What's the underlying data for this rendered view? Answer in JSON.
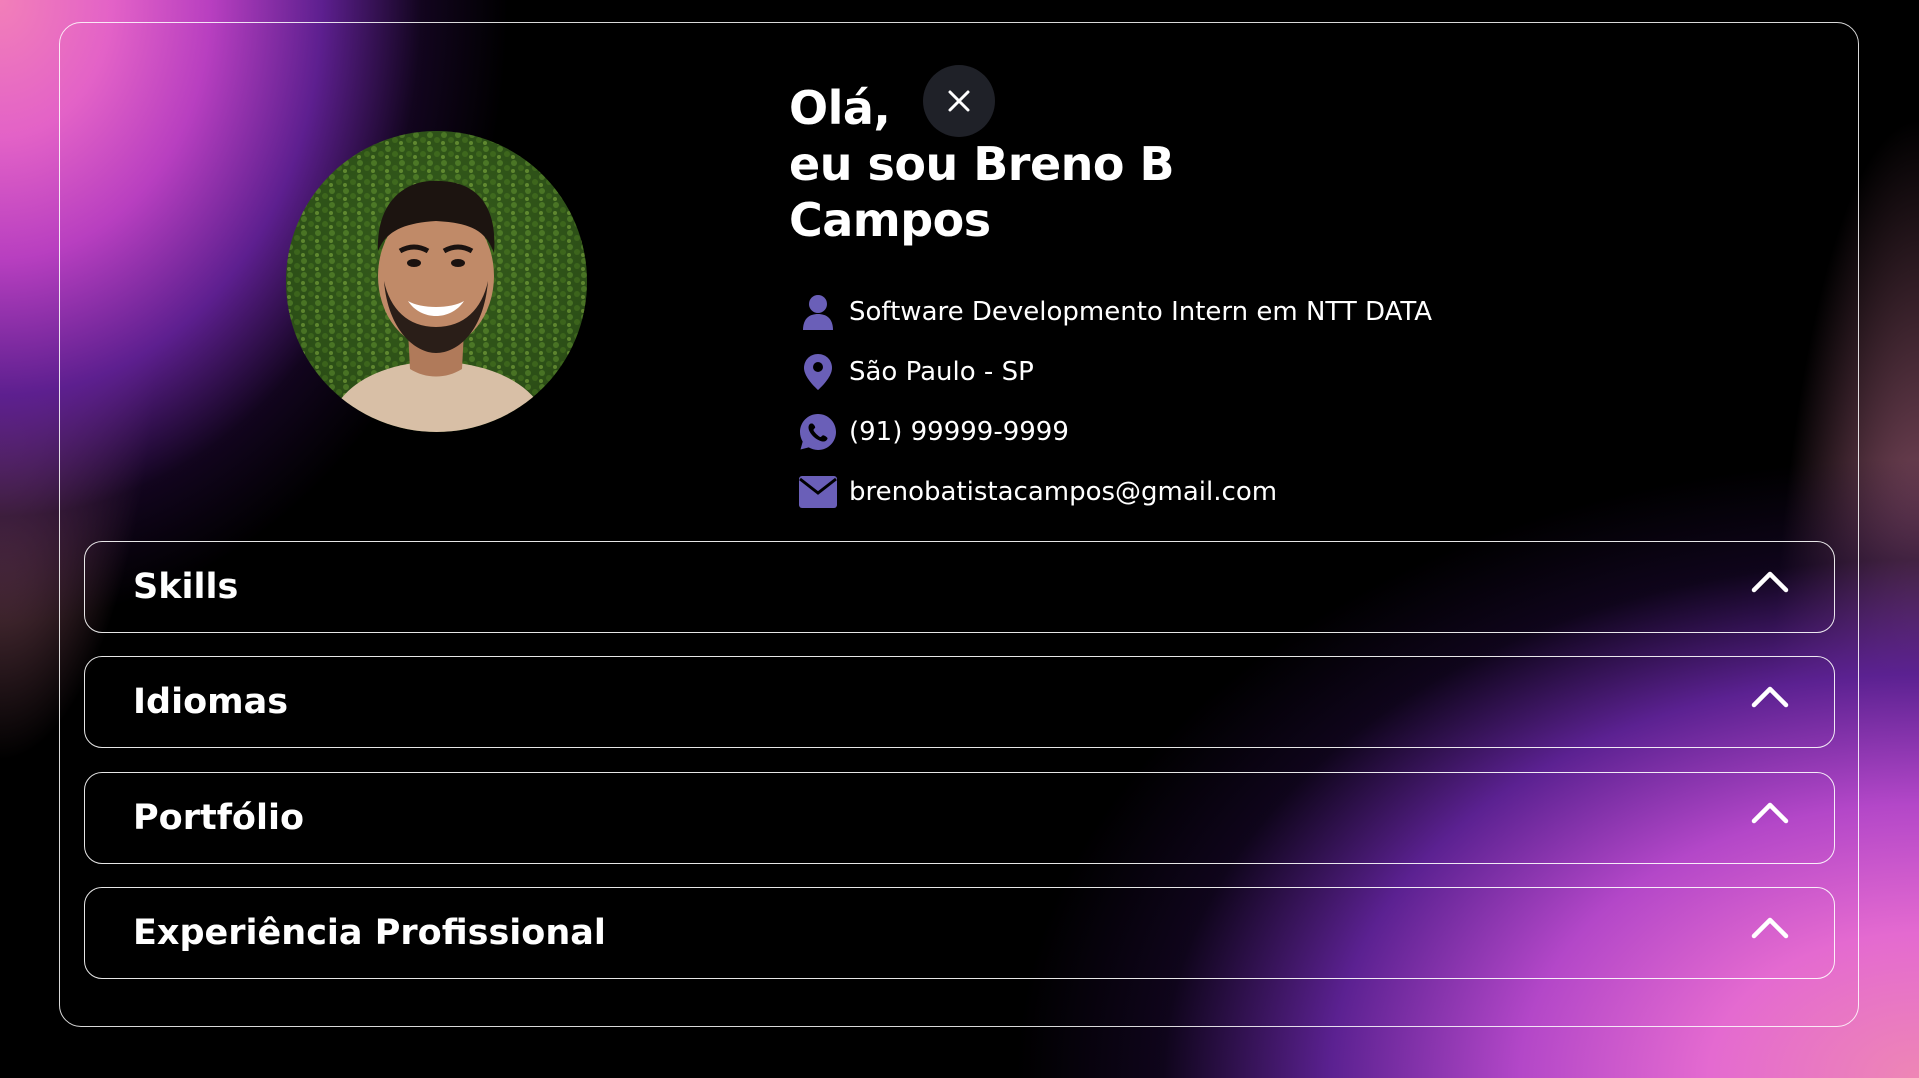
{
  "profile": {
    "greeting_line1": "Olá,",
    "greeting_line2": "eu sou Breno B",
    "greeting_line3": "Campos",
    "photo_alt": "Breno B Campos"
  },
  "close_button": {
    "icon": "close-icon"
  },
  "info": [
    {
      "icon": "user-icon",
      "text": "Software Developmento Intern em NTT DATA"
    },
    {
      "icon": "location-pin-icon",
      "text": "São Paulo - SP"
    },
    {
      "icon": "whatsapp-icon",
      "text": "(91) 99999-9999"
    },
    {
      "icon": "mail-icon",
      "text": "brenobatistacampos@gmail.com"
    }
  ],
  "sections": [
    {
      "title": "Skills",
      "icon": "chevron-up-icon"
    },
    {
      "title": "Idiomas",
      "icon": "chevron-up-icon"
    },
    {
      "title": "Portfólio",
      "icon": "chevron-up-icon"
    },
    {
      "title": "Experiência Profissional",
      "icon": "chevron-up-icon"
    }
  ],
  "colors": {
    "icon_accent": "#6a5fb8",
    "gradient_pink": "#ee86b5",
    "gradient_purple": "#b347c8"
  }
}
